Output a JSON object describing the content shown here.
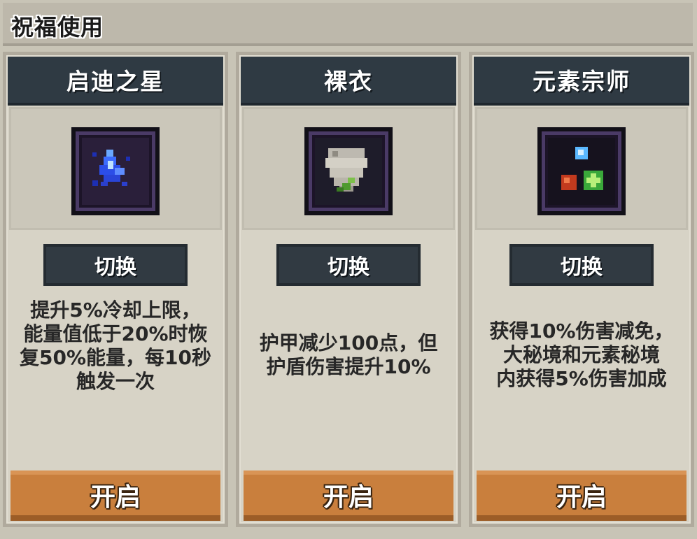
{
  "window": {
    "title": "祝福使用"
  },
  "colors": {
    "header_dark": "#2f3a43",
    "open_button_orange": "#c97f3d",
    "card_bg": "#d7d3c6"
  },
  "cards": [
    {
      "title": "启迪之星",
      "icon": "blue-crystal-star-icon",
      "switch_label": "切换",
      "description": "提升5%冷却上限，\n能量值低于20%时恢\n复50%能量，每10秒\n触发一次",
      "open_label": "开启"
    },
    {
      "title": "裸衣",
      "icon": "torn-cloth-icon",
      "switch_label": "切换",
      "description": "护甲减少100点，但\n护盾伤害提升10%",
      "open_label": "开启"
    },
    {
      "title": "元素宗师",
      "icon": "elemental-orbs-icon",
      "switch_label": "切换",
      "description": "获得10%伤害减免，\n大秘境和元素秘境\n内获得5%伤害加成",
      "open_label": "开启"
    }
  ]
}
